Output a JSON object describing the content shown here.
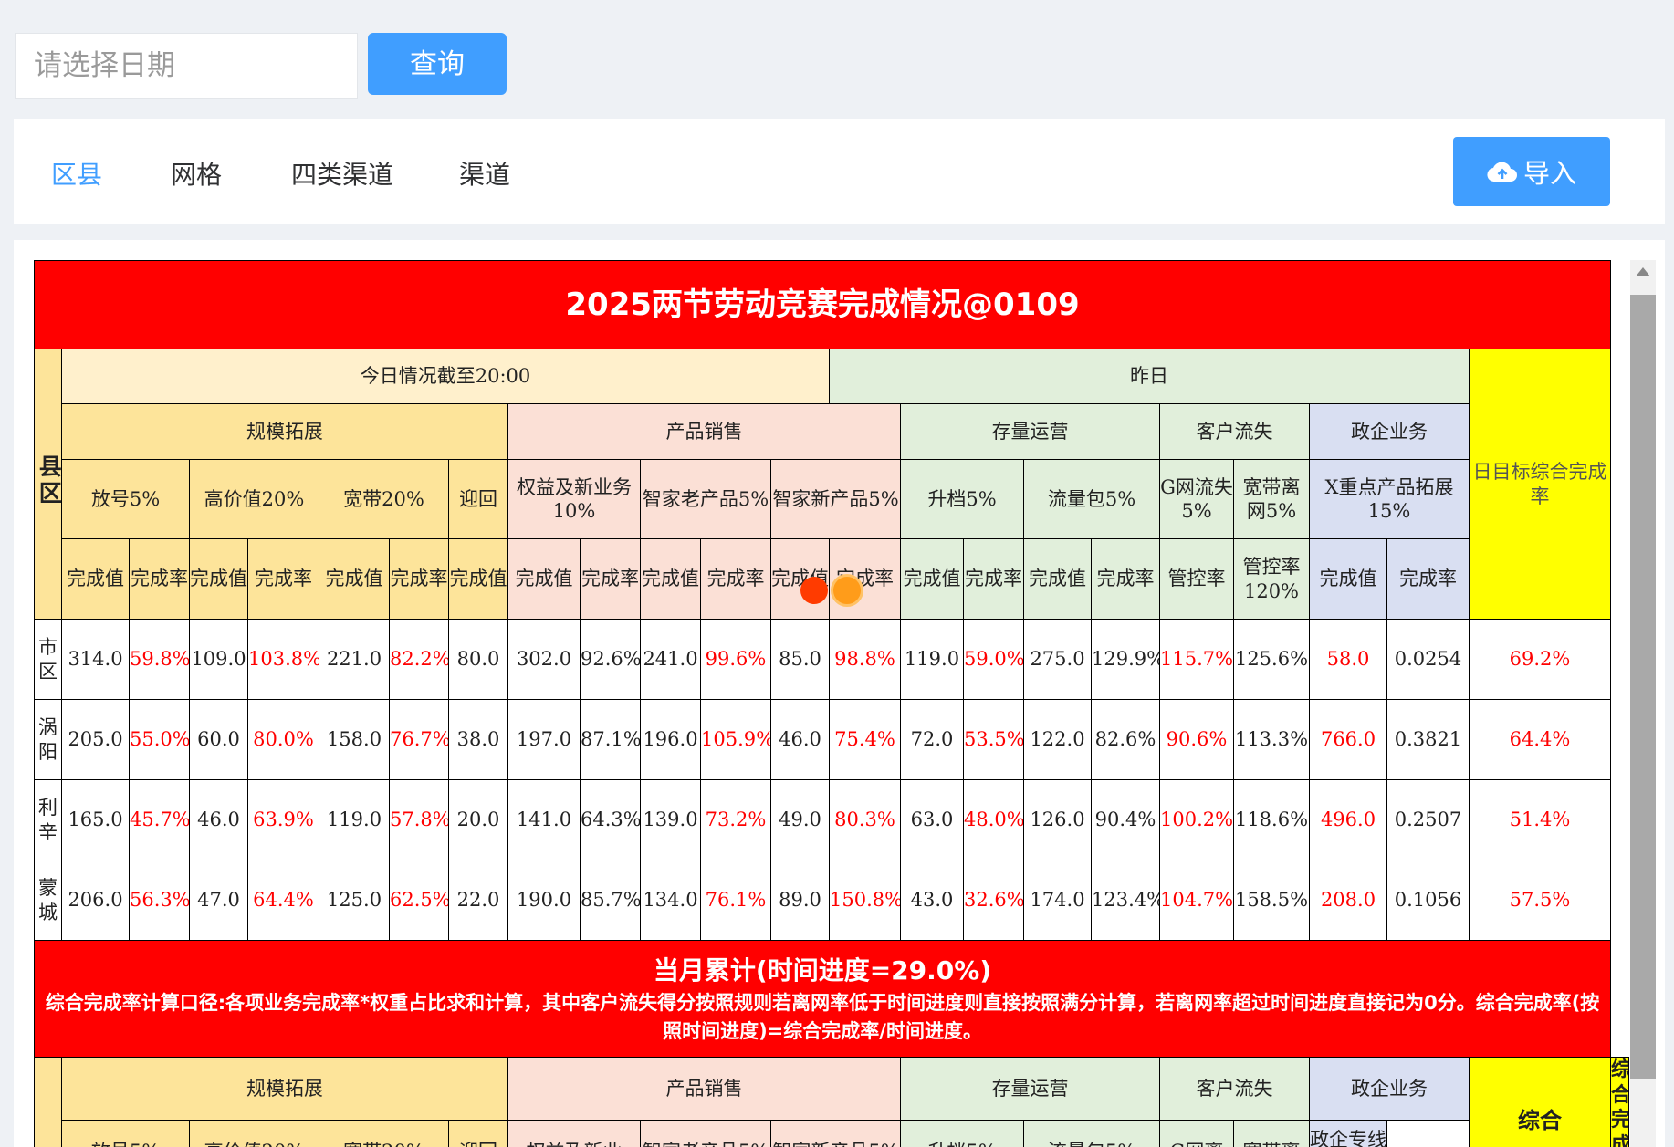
{
  "search": {
    "placeholder": "请选择日期",
    "query_label": "查询"
  },
  "tabs": [
    {
      "label": "区县",
      "active": true
    },
    {
      "label": "网格"
    },
    {
      "label": "四类渠道"
    },
    {
      "label": "渠道"
    }
  ],
  "import_label": "导入",
  "colors": {
    "accent": "#409eff",
    "title_red": "#ff0000",
    "highlight_yellow": "#ffff00"
  },
  "report": {
    "title": "2025两节劳动竞赛完成情况@0109",
    "group_today": "今日情况截至20:00",
    "group_yesterday": "昨日",
    "county_header": "县区",
    "daily_target_header": "日目标综合完成率",
    "categories": {
      "scale": "规模拓展",
      "product": "产品销售",
      "stock": "存量运营",
      "churn": "客户流失",
      "gov": "政企业务"
    },
    "subcategories": {
      "fanghao": "放号5%",
      "gaojiazhi": "高价值20%",
      "kuandai": "宽带20%",
      "yinghui": "迎回",
      "quanyi": "权益及新业务10%",
      "zhijia_old": "智家老产品5%",
      "zhijia_new": "智家新产品5%",
      "shengdang": "升档5%",
      "liuliang": "流量包5%",
      "g_churn": "G网流失5%",
      "kd_churn": "宽带离网5%",
      "x_product": "X重点产品拓展15%"
    },
    "metrics": {
      "value": "完成值",
      "rate": "完成率",
      "control": "管控率",
      "control120": "管控率120%"
    },
    "rows": [
      {
        "county": "市区",
        "cells": [
          "314.0",
          "59.8%",
          "109.0",
          "103.8%",
          "221.0",
          "82.2%",
          "80.0",
          "302.0",
          "92.6%",
          "241.0",
          "99.6%",
          "85.0",
          "98.8%",
          "119.0",
          "59.0%",
          "275.0",
          "129.9%",
          "115.7%",
          "125.6%",
          "58.0",
          "0.0254"
        ],
        "total": "69.2%"
      },
      {
        "county": "涡阳",
        "cells": [
          "205.0",
          "55.0%",
          "60.0",
          "80.0%",
          "158.0",
          "76.7%",
          "38.0",
          "197.0",
          "87.1%",
          "196.0",
          "105.9%",
          "46.0",
          "75.4%",
          "72.0",
          "53.5%",
          "122.0",
          "82.6%",
          "90.6%",
          "113.3%",
          "766.0",
          "0.3821"
        ],
        "total": "64.4%"
      },
      {
        "county": "利辛",
        "cells": [
          "165.0",
          "45.7%",
          "46.0",
          "63.9%",
          "119.0",
          "57.8%",
          "20.0",
          "141.0",
          "64.3%",
          "139.0",
          "73.2%",
          "49.0",
          "80.3%",
          "63.0",
          "48.0%",
          "126.0",
          "90.4%",
          "100.2%",
          "118.6%",
          "496.0",
          "0.2507"
        ],
        "total": "51.4%"
      },
      {
        "county": "蒙城",
        "cells": [
          "206.0",
          "56.3%",
          "47.0",
          "64.4%",
          "125.0",
          "62.5%",
          "22.0",
          "190.0",
          "85.7%",
          "134.0",
          "76.1%",
          "89.0",
          "150.8%",
          "43.0",
          "32.6%",
          "174.0",
          "123.4%",
          "104.7%",
          "158.5%",
          "208.0",
          "0.1056"
        ],
        "total": "57.5%"
      }
    ],
    "month": {
      "title": "当月累计(时间进度=29.0%)",
      "note": "综合完成率计算口径:各项业务完成率*权重占比求和计算，其中客户流失得分按照规则若离网率低于时间进度则直接按照满分计算，若离网率超过时间进度直接记为0分。综合完成率(按照时间进度)=综合完成率/时间进度。",
      "sub_quanyi": "权益及新业",
      "sub_g": "G网离",
      "sub_kd": "宽带离",
      "sub_gov": "政企专线+X重",
      "composite": "综合",
      "composite_rate": "综合完成率"
    }
  }
}
